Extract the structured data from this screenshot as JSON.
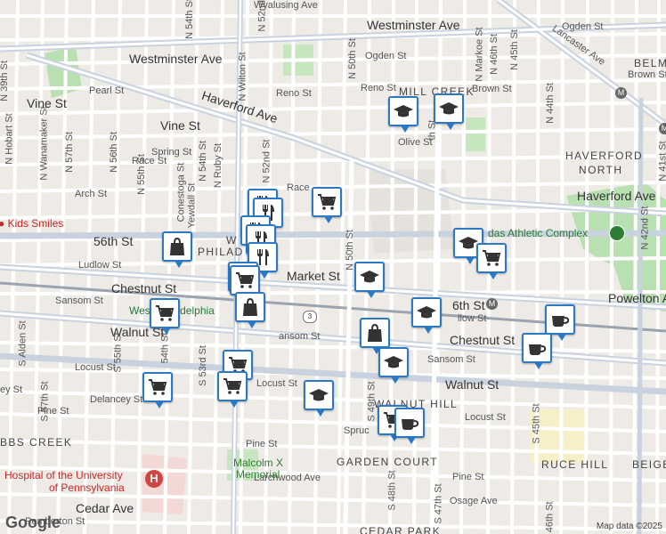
{
  "map": {
    "credit": "Map data ©2025",
    "logo": "Google",
    "colors": {
      "road": "#ffffff",
      "major_road": "#b7c3d6",
      "park": "#b9e0b1",
      "rail": "#9aa4b1",
      "pin_border": "#2b78c5",
      "poi_red": "#c62828"
    },
    "streets": {
      "wyalusing": "Wyalusing Ave",
      "westminster_1": "Westminster Ave",
      "westminster_2": "Westminster Ave",
      "ogden_1": "Ogden St",
      "ogden_2": "Ogden St",
      "pearl": "Pearl St",
      "vine_1": "Vine St",
      "vine_2": "Vine St",
      "haverford_1": "Haverford Ave",
      "haverford_2": "Haverford Ave",
      "reno_1": "Reno St",
      "reno_2": "Reno St",
      "brown": "Brown St",
      "brown_2": "Brown St",
      "olive": "Olive St",
      "spring": "Spring St",
      "race_1": "Race St",
      "race_2": "Race",
      "arch": "Arch St",
      "56th": "56th St",
      "ludlow_1": "Ludlow St",
      "ludlow_2": "llow St",
      "market": "Market St",
      "chestnut_1": "Chestnut St",
      "chestnut_2": "Chestnut St",
      "sansom_1": "Sansom St",
      "sansom_2": "ansom St",
      "sansom_3": "Sansom St",
      "walnut_1": "Walnut St",
      "walnut_2": "Walnut St",
      "locust_1": "Locust St",
      "locust_2": "Locust St",
      "locust_3": "Locust St",
      "delancey": "Delancey St",
      "delancey_2": "ey St",
      "pine_1": "Pine St",
      "pine_2": "Pine St",
      "pine_3": "Pine St",
      "spruce": "Spruc",
      "larchwood": "Larchwood Ave",
      "cedar": "Cedar Ave",
      "pemberton": "Pemberton St",
      "osage": "Osage Ave",
      "powelton": "Powelton Ave",
      "lancaster": "Lancaster Ave",
      "n_hobart": "N Hobart St",
      "n_wanamaker": "N Wanamaker St",
      "n_57th": "N 57th St",
      "n_56th": "N 56th St",
      "n_55th": "N 55th St",
      "n_54th": "N 54th St",
      "n_54th_top": "N 54th St",
      "n_ruby": "N Ruby St",
      "n_wilton": "N Wilton St",
      "n_52nd": "N 52nd St",
      "n_52nd_top": "N 52nd St",
      "n_50th": "N 50th St",
      "n_50th_low": "N 50th St",
      "n_49th": "N 49th St",
      "n_48th": "th St",
      "n_markoe": "N Markoe St",
      "n_46th": "N 46th St",
      "n_45th": "N 45th St",
      "n_44th": "N 44th St",
      "n_42nd": "N 42nd St",
      "n_41st": "N 41st St",
      "n_39th": "N 39th St",
      "n_conestoga": "Conestoga St",
      "n_yewdall": "Yewdall St",
      "s_alden": "S Alden St",
      "s_57th": "S 57th St",
      "s_55th": "S 55th St",
      "s_54th": "54th St",
      "s_53rd": "S 53rd St",
      "s_49th": "S 49th St",
      "s_48th": "S 48th St",
      "s_47th": "S 47th St",
      "s_45th": "S 45th St",
      "s_46th": "S 46th St"
    },
    "neighborhoods": {
      "mill_creek": "MILL CREEK",
      "haverford_north_1": "HAVERFORD",
      "haverford_north_2": "NORTH",
      "belm": "BELM",
      "philad": "PHILAD",
      "walnut_hill": "WALNUT HILL",
      "garden_court": "GARDEN COURT",
      "spruce_hill": "RUCE HILL",
      "beige": "BEIGE",
      "cobbs_creek": "BBS CREEK",
      "cedar_park": "CEDAR PARK"
    },
    "pois": {
      "kids_smiles": "Kids Smiles",
      "west_philadelphia": "West Philadelphia",
      "hospital_1": "Hospital of the University",
      "hospital_2": "of Pennsylvania",
      "athletic_complex": "das Athletic Complex",
      "malcolm_1": "Malcolm X",
      "malcolm_2": "Memorial",
      "route": "3",
      "metro_1": "M",
      "metro_2": "M",
      "metro_3": "M",
      "partial_w": "W",
      "partial_56th": "6th St"
    }
  },
  "markers": [
    {
      "type": "school",
      "icon": "graduation-cap-icon"
    },
    {
      "type": "school",
      "icon": "graduation-cap-icon"
    },
    {
      "type": "grocery",
      "icon": "shopping-cart-icon"
    },
    {
      "type": "shopping",
      "icon": "shopping-bag-icon"
    },
    {
      "type": "restaurant",
      "icon": "fork-knife-icon"
    },
    {
      "type": "restaurant",
      "icon": "fork-knife-icon"
    },
    {
      "type": "restaurant",
      "icon": "fork-knife-icon"
    },
    {
      "type": "restaurant",
      "icon": "fork-knife-icon"
    },
    {
      "type": "restaurant",
      "icon": "fork-knife-icon"
    },
    {
      "type": "shopping",
      "icon": "shopping-bag-icon"
    },
    {
      "type": "grocery",
      "icon": "shopping-cart-icon"
    },
    {
      "type": "shopping",
      "icon": "shopping-bag-icon"
    },
    {
      "type": "grocery",
      "icon": "shopping-cart-icon"
    },
    {
      "type": "grocery",
      "icon": "shopping-cart-icon"
    },
    {
      "type": "grocery",
      "icon": "shopping-cart-icon"
    },
    {
      "type": "school",
      "icon": "graduation-cap-icon"
    },
    {
      "type": "school",
      "icon": "graduation-cap-icon"
    },
    {
      "type": "shopping",
      "icon": "shopping-bag-icon"
    },
    {
      "type": "school",
      "icon": "graduation-cap-icon"
    },
    {
      "type": "school",
      "icon": "graduation-cap-icon"
    },
    {
      "type": "school",
      "icon": "graduation-cap-icon"
    },
    {
      "type": "grocery",
      "icon": "shopping-cart-icon"
    },
    {
      "type": "grocery",
      "icon": "shopping-cart-icon"
    },
    {
      "type": "grocery",
      "icon": "shopping-cart-icon"
    },
    {
      "type": "cafe",
      "icon": "coffee-cup-icon"
    },
    {
      "type": "cafe",
      "icon": "coffee-cup-icon"
    },
    {
      "type": "cafe",
      "icon": "coffee-cup-icon"
    }
  ]
}
